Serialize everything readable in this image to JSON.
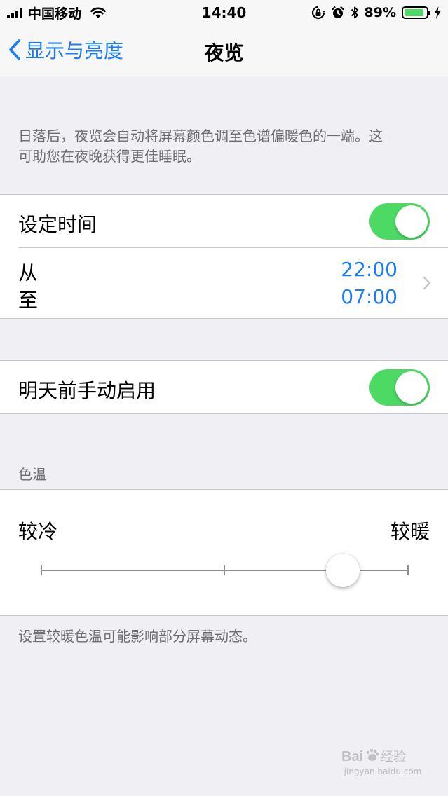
{
  "status_bar": {
    "carrier": "中国移动",
    "time": "14:40",
    "battery_percent": "89%",
    "battery_level": 0.89,
    "icons": [
      "signal-icon",
      "wifi-icon",
      "orientation-lock-icon",
      "alarm-icon",
      "bluetooth-icon",
      "battery-icon",
      "charging-icon"
    ]
  },
  "nav": {
    "back_label": "显示与亮度",
    "title": "夜览"
  },
  "intro": {
    "line1": "日落后，夜览会自动将屏幕颜色调至色谱偏暖色的一端。这",
    "line2": "可助您在夜晚获得更佳睡眠。"
  },
  "schedule": {
    "label": "设定时间",
    "enabled": true,
    "from_label": "从",
    "to_label": "至",
    "from_time": "22:00",
    "to_time": "07:00"
  },
  "manual": {
    "label": "明天前手动启用",
    "enabled": true
  },
  "color_temp": {
    "header": "色温",
    "less_warm": "较冷",
    "more_warm": "较暖",
    "level": 0.82
  },
  "footer_note": "设置较暖色温可能影响部分屏幕动态。",
  "watermark": {
    "brand": "Bai 经验",
    "url": "jingyan.baidu.com"
  },
  "colors": {
    "accent": "#1a7cf5",
    "switch_on": "#4cd964",
    "background": "#efeff4"
  }
}
